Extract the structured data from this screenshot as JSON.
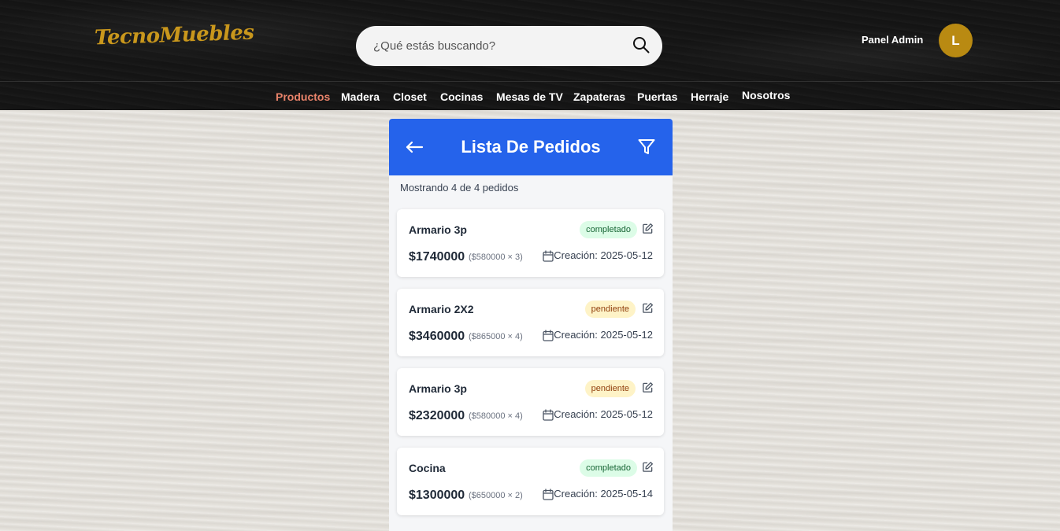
{
  "header": {
    "logo": "TecnoMuebles",
    "search_placeholder": "¿Qué estás buscando?",
    "admin_label": "Panel Admin",
    "avatar_initial": "L"
  },
  "nav": {
    "items": [
      {
        "label": "Productos",
        "active": true
      },
      {
        "label": "Madera"
      },
      {
        "label": "Closet"
      },
      {
        "label": "Cocinas"
      },
      {
        "label": "Mesas de TV"
      },
      {
        "label": "Zapateras"
      },
      {
        "label": "Puertas"
      },
      {
        "label": "Herraje"
      },
      {
        "label": "Nosotros"
      }
    ]
  },
  "panel": {
    "title": "Lista De Pedidos",
    "count_text": "Mostrando 4 de 4 pedidos",
    "header_color": "#2563eb"
  },
  "orders": [
    {
      "name": "Armario 3p",
      "status": "completado",
      "total": "$1740000",
      "detail": "($580000 × 3)",
      "date": "Creación: 2025-05-12"
    },
    {
      "name": "Armario 2X2",
      "status": "pendiente",
      "total": "$3460000",
      "detail": "($865000 × 4)",
      "date": "Creación: 2025-05-12"
    },
    {
      "name": "Armario 3p",
      "status": "pendiente",
      "total": "$2320000",
      "detail": "($580000 × 4)",
      "date": "Creación: 2025-05-12"
    },
    {
      "name": "Cocina",
      "status": "completado",
      "total": "$1300000",
      "detail": "($650000 × 2)",
      "date": "Creación: 2025-05-14"
    }
  ],
  "icons": {
    "search": "search-icon",
    "back": "arrow-left-icon",
    "filter": "filter-icon",
    "edit": "edit-icon",
    "calendar": "calendar-icon"
  }
}
